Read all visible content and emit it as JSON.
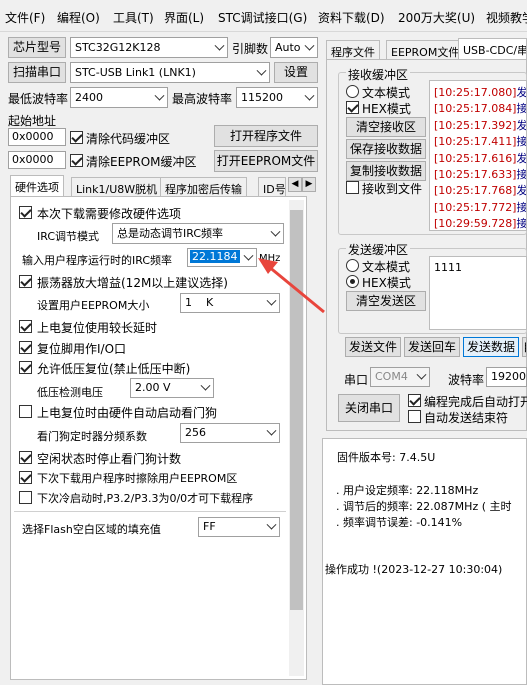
{
  "menu": [
    "文件(F)",
    "编程(O)",
    "工具(T)",
    "界面(L)",
    "STC调试接口(G)",
    "资料下载(D)",
    "200万大奖(U)",
    "视频教学"
  ],
  "chip": {
    "label": "芯片型号",
    "value": "STC32G12K128",
    "pin_label": "引脚数",
    "pin_value": "Auto"
  },
  "port": {
    "label": "扫描串口",
    "value": "STC-USB Link1 (LNK1)",
    "settings": "设置"
  },
  "baud": {
    "min_label": "最低波特率",
    "min_value": "2400",
    "max_label": "最高波特率",
    "max_value": "115200"
  },
  "start_addr": {
    "label": "起始地址",
    "addr1": "0x0000",
    "clear_code": "清除代码缓冲区",
    "open_prog": "打开程序文件",
    "addr2": "0x0000",
    "clear_eeprom": "清除EEPROM缓冲区",
    "open_eeprom": "打开EEPROM文件"
  },
  "left_tabs": [
    "硬件选项",
    "Link1/U8W脱机",
    "程序加密后传输",
    "ID号"
  ],
  "hw": {
    "opt_modify": "本次下载需要修改硬件选项",
    "irc_mode_label": "IRC调节模式",
    "irc_mode_value": "总是动态调节IRC频率",
    "irc_freq_label": "输入用户程序运行时的IRC频率",
    "irc_freq_value": "22.1184",
    "irc_unit": "MHz",
    "osc_gain": "振荡器放大增益(12M以上建议选择)",
    "eeprom_size_label": "设置用户EEPROM大小",
    "eeprom_size_value": "1    K",
    "power_delay": "上电复位使用较长延时",
    "reset_io": "复位脚用作I/O口",
    "low_volt": "允许低压复位(禁止低压中断)",
    "low_volt_label": "低压检测电压",
    "low_volt_value": "2.00 V",
    "wdt_auto": "上电复位时由硬件自动启动看门狗",
    "wdt_div_label": "看门狗定时器分频系数",
    "wdt_div_value": "256",
    "wdt_idle": "空闲状态时停止看门狗计数",
    "erase_eeprom": "下次下载用户程序时擦除用户EEPROM区",
    "p32_p33": "下次冷启动时,P3.2/P3.3为0/0才可下载程序",
    "flash_fill_label": "选择Flash空白区域的填充值",
    "flash_fill_value": "FF"
  },
  "right_tabs": [
    "程序文件",
    "EEPROM文件",
    "USB-CDC/串口"
  ],
  "recv": {
    "group": "接收缓冲区",
    "text_mode": "文本模式",
    "hex_mode": "HEX模式",
    "clear": "清空接收区",
    "save": "保存接收数据",
    "copy": "复制接收数据",
    "to_file": "接收到文件",
    "lines": [
      {
        "ts": "[10:25:17.080]",
        "t": "发"
      },
      {
        "ts": "[10:25:17.084]",
        "t": "接"
      },
      {
        "ts": "[10:25:17.392]",
        "t": "发"
      },
      {
        "ts": "[10:25:17.411]",
        "t": "接"
      },
      {
        "ts": "[10:25:17.616]",
        "t": "发"
      },
      {
        "ts": "[10:25:17.633]",
        "t": "接"
      },
      {
        "ts": "[10:25:17.768]",
        "t": "发"
      },
      {
        "ts": "[10:25:17.772]",
        "t": "接"
      },
      {
        "ts": "[10:29:59.728]",
        "t": "接"
      }
    ]
  },
  "send": {
    "group": "发送缓冲区",
    "text_mode": "文本模式",
    "hex_mode": "HEX模式",
    "clear": "清空发送区",
    "content": "1111",
    "send_file": "发送文件",
    "send_return": "发送回车",
    "send_data": "发送数据",
    "auto": "自"
  },
  "serial": {
    "port_label": "串口",
    "port_value": "COM4",
    "baud_label": "波特率",
    "baud_value": "19200",
    "close": "关闭串口",
    "auto_open": "编程完成后自动打开",
    "auto_end": "自动发送结束符"
  },
  "status": [
    "固件版本号: 7.4.5U",
    "",
    "  . 用户设定频率: 22.118MHz",
    "  . 调节后的频率: 22.087MHz ( 主时",
    "  . 频率调节误差: -0.141%",
    "",
    "",
    "操作成功 !(2023-12-27 10:30:04)"
  ],
  "colors": {
    "arrow": "#e8453c",
    "highlight": "#0078d7",
    "log_ts": "#c00000",
    "log_text": "#000080"
  }
}
